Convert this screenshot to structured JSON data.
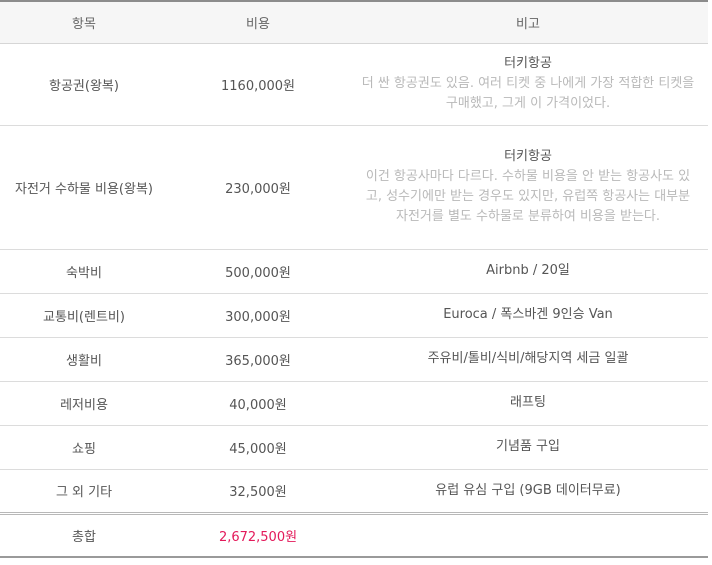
{
  "header": {
    "item": "항목",
    "cost": "비용",
    "note": "비고"
  },
  "rows": [
    {
      "item": "항공권(왕복)",
      "cost": "1160,000원",
      "note_title": "터키항공",
      "note_detail": "더 싼 항공권도 있음. 여러 티켓 중 나에게 가장 적합한 티켓을 구매했고, 그게 이 가격이었다."
    },
    {
      "item": "자전거 수하물 비용(왕복)",
      "cost": "230,000원",
      "note_title": "터키항공",
      "note_detail": "이건 항공사마다 다르다. 수하물 비용을 안 받는 항공사도 있고, 성수기에만 받는 경우도 있지만, 유럽쪽 항공사는 대부분 자전거를 별도 수하물로 분류하여 비용을 받는다."
    },
    {
      "item": "숙박비",
      "cost": "500,000원",
      "note": "Airbnb / 20일"
    },
    {
      "item": "교통비(렌트비)",
      "cost": "300,000원",
      "note": "Euroca / 폭스바겐 9인승 Van"
    },
    {
      "item": "생활비",
      "cost": "365,000원",
      "note": "주유비/톨비/식비/해당지역 세금 일괄"
    },
    {
      "item": "레저비용",
      "cost": "40,000원",
      "note": "래프팅"
    },
    {
      "item": "쇼핑",
      "cost": "45,000원",
      "note": "기념품 구입"
    },
    {
      "item": "그 외 기타",
      "cost": "32,500원",
      "note": "유럽 유심 구입 (9GB 데이터무료)"
    }
  ],
  "total": {
    "item": "총합",
    "cost": "2,672,500원"
  },
  "colors": {
    "total_accent": "#e3195a",
    "muted_text": "#b9b9b9",
    "header_bg": "#f6f6f6"
  }
}
